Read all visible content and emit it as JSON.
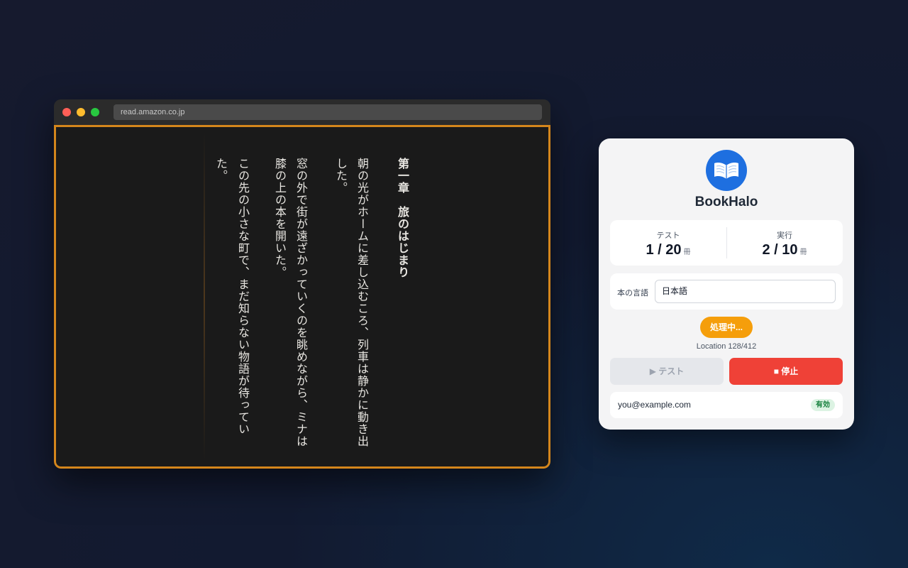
{
  "browser": {
    "url": "read.amazon.co.jp"
  },
  "book": {
    "chapter_title": "第一章　旅のはじまり",
    "lines": [
      "朝の光がホームに差し込むころ、列車は静かに動き出",
      "した。",
      "窓の外で街が遠ざかっていくのを眺めながら、ミナは",
      "膝の上の本を開いた。",
      "この先の小さな町で、まだ知らない物語が待ってい",
      "た。"
    ]
  },
  "extension": {
    "name": "BookHalo",
    "logo_icon": "open-book-icon",
    "brand_color": "#1e6fe0",
    "stats": {
      "test": {
        "label": "テスト",
        "value": "1 / 20",
        "unit": "冊"
      },
      "run": {
        "label": "実行",
        "value": "2 / 10",
        "unit": "冊"
      }
    },
    "language": {
      "label": "本の言語",
      "selected": "日本語"
    },
    "status": {
      "label": "処理中...",
      "color": "#f59e0b"
    },
    "location": "Location 128/412",
    "buttons": {
      "test": "▶ テスト",
      "stop": "■ 停止",
      "stop_color": "#ef4137"
    },
    "account": {
      "email": "you@example.com",
      "badge": "有効"
    }
  }
}
